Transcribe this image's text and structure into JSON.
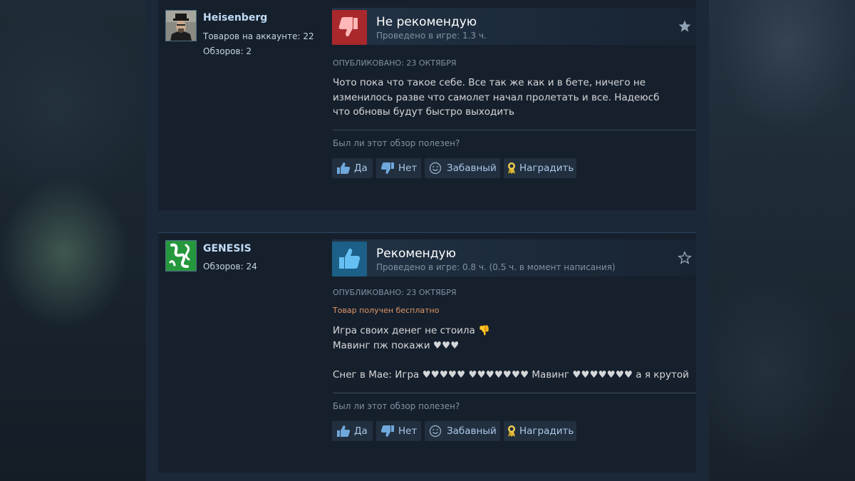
{
  "reviews": [
    {
      "author": {
        "name": "Heisenberg",
        "products_label": "Товаров на аккаунте: 22",
        "reviews_label": "Обзоров: 2"
      },
      "verdict": "Не рекомендую",
      "playtime": "Проведено в игре: 1.3 ч.",
      "posted": "ОПУБЛИКОВАНО: 23 ОКТЯБРЯ",
      "body_lines": [
        "Чото пока что такое себе. Все так же как и в бете, ничего не",
        "изменилось разве что самолет начал пролетать и все. Надеюсб",
        "что обновы будут быстро выходить"
      ],
      "helpful_question": "Был ли этот обзор полезен?",
      "buttons": {
        "yes": "Да",
        "no": "Нет",
        "funny": "Забавный",
        "award": "Наградить"
      }
    },
    {
      "author": {
        "name": "GENESIS",
        "reviews_label": "Обзоров: 24"
      },
      "verdict": "Рекомендую",
      "playtime": "Проведено в игре: 0.8 ч. (0.5 ч. в момент написания)",
      "posted": "ОПУБЛИКОВАНО: 23 ОКТЯБРЯ",
      "free_note": "Товар получен бесплатно",
      "body_lines": [
        "Игра своих денег не стоила 👎",
        "Мавинг пж покажи ♥♥♥",
        "",
        "Снег в Мае: Игра ♥♥♥♥♥ ♥♥♥♥♥♥♥ Мавинг ♥♥♥♥♥♥♥ а я крутой"
      ],
      "helpful_question": "Был ли этот обзор полезен?",
      "buttons": {
        "yes": "Да",
        "no": "Нет",
        "funny": "Забавный",
        "award": "Наградить"
      }
    }
  ],
  "colors": {
    "negative_thumb_bg": "#a8282c",
    "positive_thumb_bg": "#1c5f87",
    "author_name": "#c1dbf4",
    "free_note": "#e09665",
    "button_text": "#a9c7e8"
  },
  "icons": {
    "verdict_negative": "thumbs-down-icon",
    "verdict_positive": "thumbs-up-icon",
    "favorite": "star-icon",
    "yes": "thumbs-up-icon",
    "no": "thumbs-down-icon",
    "funny": "smiley-icon",
    "award": "award-ribbon-icon"
  }
}
